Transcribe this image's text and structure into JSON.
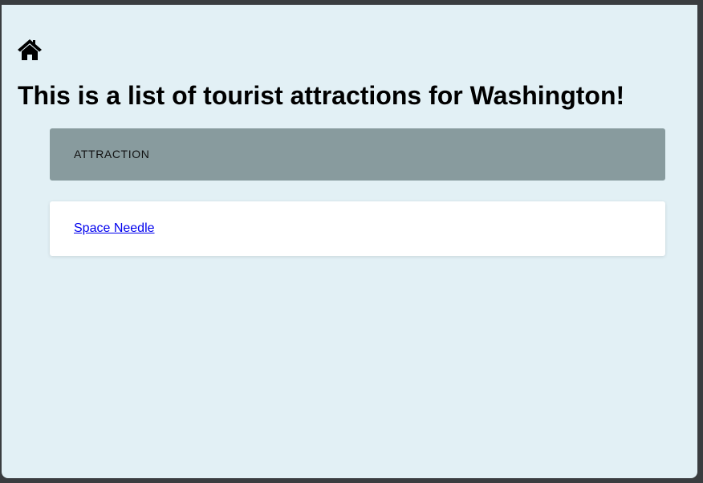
{
  "header": {
    "home_icon": "home-icon",
    "title": "This is a list of tourist attractions for Washington!"
  },
  "table": {
    "column_header": "ATTRACTION",
    "rows": [
      {
        "name": "Space Needle"
      }
    ]
  },
  "colors": {
    "background": "#e2f0f5",
    "header_bg": "#889b9e",
    "row_bg": "#ffffff",
    "link": "#0000ee"
  }
}
